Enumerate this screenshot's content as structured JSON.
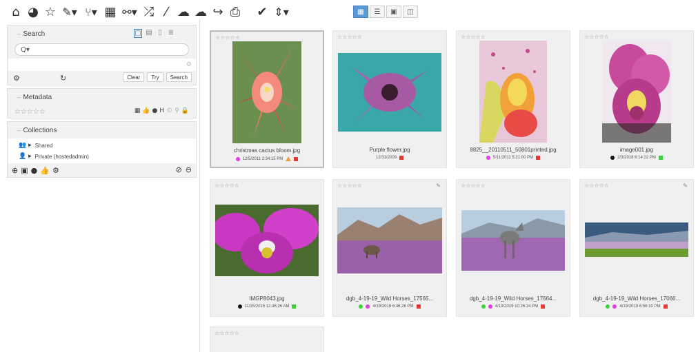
{
  "toolbar": {
    "icons": [
      "home-icon",
      "dashboard-icon",
      "star-icon",
      "edit-icon",
      "branch-icon",
      "calendar-icon",
      "link-icon",
      "shuffle-icon",
      "magic-wand-icon",
      "cloud-upload-icon",
      "cloud-download-icon",
      "share-icon",
      "print-icon",
      "check-icon",
      "sort-icon"
    ],
    "glyphs": {
      "home": "⌂",
      "dashboard": "◕",
      "star": "☆",
      "edit": "✎▾",
      "branch": "⑂▾",
      "calendar": "▦",
      "link": "⚯▾",
      "shuffle": "⤮",
      "wand": "⁄",
      "cloud_up": "☁",
      "cloud_down": "☁",
      "share": "↪",
      "print": "⎙",
      "check": "✔",
      "sort": "⇕▾"
    },
    "views": [
      {
        "name": "grid-view",
        "glyph": "▦",
        "active": true
      },
      {
        "name": "list-view",
        "glyph": "☰",
        "active": false
      },
      {
        "name": "image-view",
        "glyph": "▣",
        "active": false
      },
      {
        "name": "detail-view",
        "glyph": "◫",
        "active": false
      }
    ]
  },
  "search": {
    "title": "Search",
    "caret": "–",
    "input_prefix": "Q▾",
    "mode_glyphs": [
      "▢",
      "▤",
      "▯",
      "≣"
    ],
    "clear_label": "Clear",
    "try_label": "Try",
    "search_label": "Search",
    "gear_glyph": "⚙",
    "refresh_glyph": "↻",
    "small_gear_glyph": "⚙"
  },
  "metadata": {
    "title": "Metadata",
    "caret": "–",
    "stars": "☆☆☆☆☆",
    "icon_glyphs": [
      "▦",
      "👍",
      "●",
      "H",
      "©",
      "⚲",
      "🔒"
    ]
  },
  "collections": {
    "title": "Collections",
    "caret": "–",
    "items": [
      {
        "glyph": "👥 ▸",
        "label": "Shared"
      },
      {
        "glyph": "👤 ▸",
        "label": "Private (hostedadmin)"
      }
    ],
    "footer_left": [
      "⊕",
      "▣",
      "●",
      "👍",
      "⚙"
    ],
    "footer_right": [
      "⊘",
      "⊖"
    ]
  },
  "cards": [
    {
      "stars": "☆☆☆☆☆",
      "filename": "christmas cactus bloom.jpg",
      "date": "12/5/2011 2:34:15 PM",
      "dot": "#e040e0",
      "flags": [
        "tri",
        "#e53935"
      ],
      "selected": true,
      "edit": false
    },
    {
      "stars": "☆☆☆☆☆",
      "filename": "Purple flower.jpg",
      "date": "12/31/2009",
      "dot": null,
      "flags": [
        "#e53935"
      ],
      "selected": false,
      "edit": false
    },
    {
      "stars": "☆☆☆☆☆",
      "filename": "8825__20110511_50801printed.jpg",
      "date": "5/11/2011 5:21:00 PM",
      "dot": "#e040e0",
      "flags": [
        "#e53935"
      ],
      "selected": false,
      "edit": false
    },
    {
      "stars": "☆☆☆☆☆",
      "filename": "image001.jpg",
      "date": "2/3/2016 6:14:22 PM",
      "dot": "#111111",
      "flags": [
        "#3ad33a"
      ],
      "selected": false,
      "edit": false
    },
    {
      "stars": "☆☆☆☆☆",
      "filename": "IMGP8043.jpg",
      "date": "11/15/2015 12:46:26 AM",
      "dot": "#111111",
      "flags": [
        "#3ad33a"
      ],
      "selected": false,
      "edit": false
    },
    {
      "stars": "☆☆☆☆☆",
      "filename": "dgb_4-19-19_Wild Horses_17565...",
      "date": "4/19/2019 6:46:26 PM",
      "dot": "#3ad33a",
      "dot2": "#e040e0",
      "flags": [
        "#e53935"
      ],
      "selected": false,
      "edit": true
    },
    {
      "stars": "☆☆☆☆☆",
      "filename": "dgb_4-19-19_Wild Horses_17664...",
      "date": "4/19/2019 10:26:24 PM",
      "dot": "#3ad33a",
      "dot2": "#e040e0",
      "flags": [
        "#e53935"
      ],
      "selected": false,
      "edit": false
    },
    {
      "stars": "☆☆☆☆☆",
      "filename": "dgb_4-19-19_Wild Horses_17066...",
      "date": "4/19/2019 6:56:10 PM",
      "dot": "#3ad33a",
      "dot2": "#e040e0",
      "flags": [
        "#e53935"
      ],
      "selected": false,
      "edit": true
    },
    {
      "stars": "☆☆☆☆☆",
      "filename": "",
      "date": "",
      "dot": null,
      "flags": [],
      "selected": false,
      "edit": false
    }
  ],
  "edit_glyph": "✎"
}
